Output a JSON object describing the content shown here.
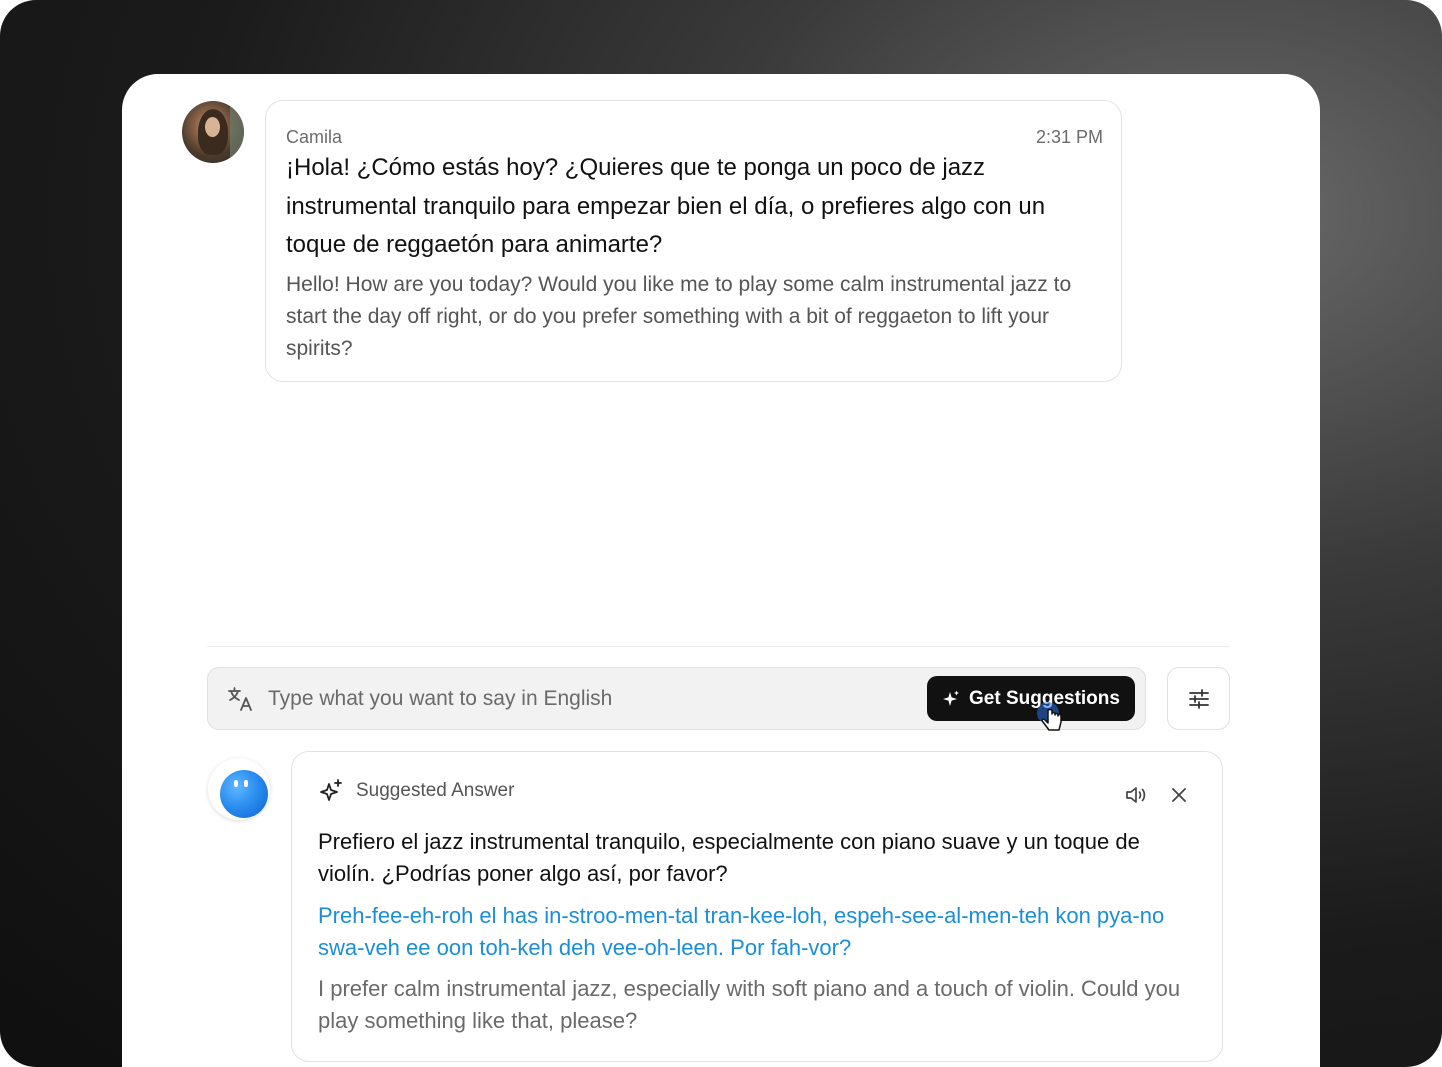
{
  "message": {
    "sender": "Camila",
    "time": "2:31 PM",
    "text_es": "¡Hola! ¿Cómo estás hoy? ¿Quieres que te ponga un poco de jazz instrumental tranquilo para empezar bien el día, o prefieres algo con un toque de reggaetón para animarte?",
    "text_en": "Hello! How are you today? Would you like me to play some calm instrumental jazz to start the day off right, or do you prefer something with a bit of reggaeton to lift your spirits?"
  },
  "composer": {
    "placeholder": "Type what you want to say in English",
    "suggest_label": "Get Suggestions"
  },
  "suggestion": {
    "title": "Suggested Answer",
    "text_es": "Prefiero el jazz instrumental tranquilo, especialmente con piano suave y un toque de violín. ¿Podrías poner algo así, por favor?",
    "pronunciation": "Preh-fee-eh-roh el has in-stroo-men-tal tran-kee-loh, espeh-see-al-men-teh kon pya-no swa-veh ee oon toh-keh deh vee-oh-leen. Por fah-vor?",
    "text_en": "I prefer calm instrumental jazz, especially with soft piano and a touch of violin. Could you play something like that, please?"
  },
  "icons": {
    "translate": "translate-icon",
    "sparkle": "sparkle-icon",
    "settings": "sliders-icon",
    "speaker": "speaker-icon",
    "close": "close-icon",
    "cursor": "hand-cursor-icon"
  },
  "colors": {
    "pronunciation": "#1a8fd8",
    "button_bg": "#111111",
    "bot_avatar": "#2b8ef0"
  }
}
